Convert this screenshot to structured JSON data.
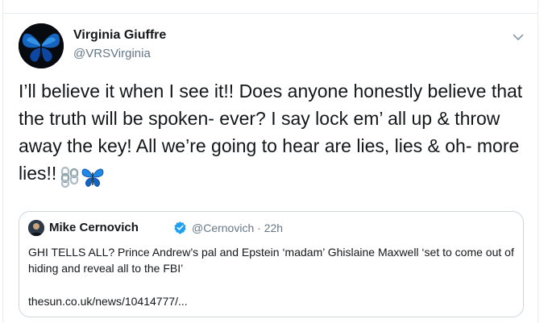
{
  "tweet": {
    "author": {
      "display_name": "Virginia Giuffre",
      "handle": "@VRSVirginia",
      "avatar_icon": "blue-butterfly-icon"
    },
    "menu_icon": "chevron-down-icon",
    "text": "I’ll believe it when I see it!! Does anyone honestly believe that the truth will be spoken- ever? I say lock em’ all up & throw away the key! All we’re going to hear are lies, lies & oh- more lies!!",
    "emojis": [
      "chains-icon",
      "butterfly-icon"
    ]
  },
  "quoted_tweet": {
    "author": {
      "display_name": "Mike Cernovich",
      "verified_icon": "verified-badge-icon",
      "handle": "@Cernovich",
      "separator": "·",
      "time": "22h"
    },
    "text": "GHI TELLS ALL? Prince Andrew’s pal and Epstein ‘madam’ Ghislaine Maxwell ‘set to come out of hiding and reveal all to the FBI’",
    "link": "thesun.co.uk/news/10414777/..."
  },
  "colors": {
    "text": "#14171a",
    "secondary": "#657786",
    "border": "#ccd6dd",
    "verified": "#1da1f2",
    "butterfly": "#1e88e5"
  }
}
